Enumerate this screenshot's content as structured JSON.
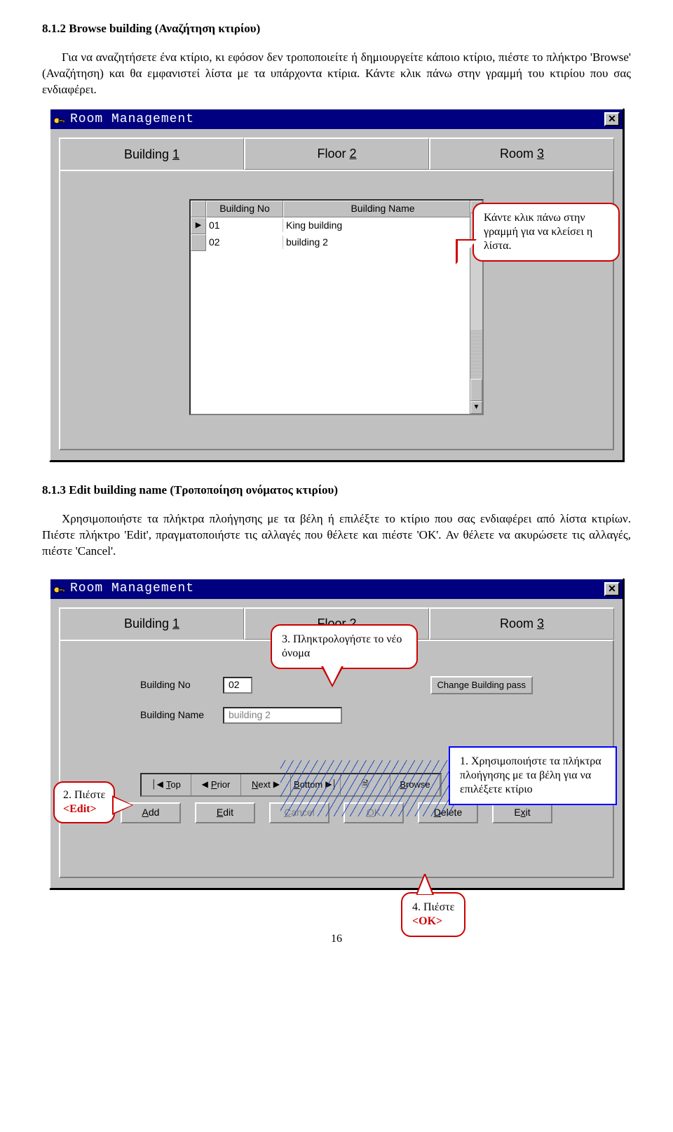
{
  "section1": {
    "title": "8.1.2 Browse building (Αναζήτηση κτιρίου)",
    "para": "Για να αναζητήσετε ένα κτίριο, κι εφόσον δεν τροποποιείτε ή δημιουργείτε κάποιο κτίριο, πιέστε το πλήκτρο 'Browse' (Αναζήτηση) και θα εμφανιστεί λίστα με τα υπάρχοντα κτίρια. Κάντε κλικ πάνω στην γραμμή του κτιρίου που σας ενδιαφέρει."
  },
  "window": {
    "title": "Room Management",
    "tabs": {
      "t1a": "Building ",
      "t1b": "1",
      "t2a": "Floor ",
      "t2b": "2",
      "t3a": "Room ",
      "t3b": "3"
    }
  },
  "listbox": {
    "headers": {
      "no": "Building No",
      "name": "Building Name"
    },
    "rows": [
      {
        "no": "01",
        "name": "King building"
      },
      {
        "no": "02",
        "name": "building 2"
      }
    ]
  },
  "callouts": {
    "c1": "Κάντε κλικ πάνω στην γραμμή για να κλείσει η λίστα.",
    "c2": "3. Πληκτρολογήστε το νέο όνομα",
    "c3": "2. Πιέστε",
    "c3b": "<Edit>",
    "c4": "1. Χρησιμοποιήστε τα πλήκτρα πλοήγησης με τα βέλη για να επιλέξετε κτίριο",
    "c5a": "4. Πιέστε",
    "c5b": "<OK>"
  },
  "section2": {
    "title": "8.1.3 Edit building name (Τροποποίηση ονόματος κτιρίου)",
    "para": "Χρησιμοποιήστε τα πλήκτρα πλοήγησης με τα βέλη ή επιλέξτε το κτίριο που σας ενδιαφέρει από λίστα κτιρίων. Πιέστε πλήκτρο 'Edit', πραγματοποιήστε τις αλλαγές που θέλετε και πιέστε 'OK'. Αν θέλετε να ακυρώσετε τις αλλαγές, πιέστε 'Cancel'."
  },
  "form": {
    "lbl_no": "Building No",
    "val_no": "02",
    "lbl_name": "Building Name",
    "val_name": "building 2",
    "btn_pass": "Change Building pass"
  },
  "nav": {
    "top": "Top",
    "prior": "Prior",
    "next": "Next",
    "bottom": "Bottom",
    "browse": "Browse"
  },
  "actions": {
    "add": "Add",
    "edit": "Edit",
    "cancel": "Cancel",
    "ok": "OK",
    "delete": "Delete",
    "exit": "Exit"
  },
  "page_no": "16"
}
